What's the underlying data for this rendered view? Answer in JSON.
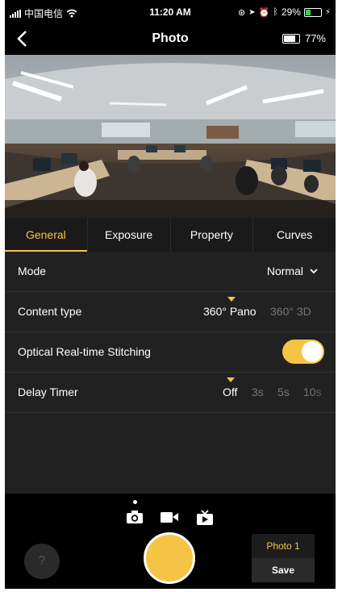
{
  "status_bar": {
    "carrier": "中国电信",
    "time": "11:20 AM",
    "battery": "29%"
  },
  "nav": {
    "title": "Photo",
    "camera_battery": "77%"
  },
  "tabs": [
    {
      "label": "General",
      "active": true
    },
    {
      "label": "Exposure",
      "active": false
    },
    {
      "label": "Property",
      "active": false
    },
    {
      "label": "Curves",
      "active": false
    }
  ],
  "settings": {
    "mode": {
      "label": "Mode",
      "value": "Normal"
    },
    "content_type": {
      "label": "Content type",
      "selected": "360° Pano",
      "options": [
        "360° Pano",
        "360° 3D"
      ]
    },
    "stitching": {
      "label": "Optical Real-time Stitching",
      "on": true
    },
    "delay_timer": {
      "label": "Delay Timer",
      "selected": "Off",
      "options": [
        "Off",
        "3s",
        "5s",
        "10s"
      ]
    }
  },
  "bottom": {
    "help": "?",
    "active_mode": "photo",
    "preset": "Photo 1",
    "save": "Save"
  },
  "colors": {
    "accent": "#f6c445",
    "panel": "#212121",
    "background": "#000000"
  },
  "icons": [
    "back-arrow-icon",
    "camera-icon",
    "video-icon",
    "timelapse-icon",
    "wifi-icon",
    "battery-icon"
  ]
}
